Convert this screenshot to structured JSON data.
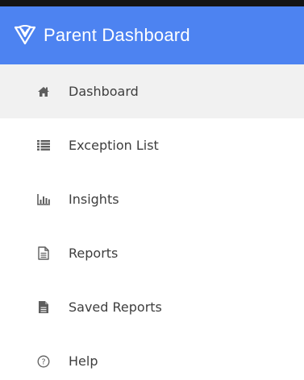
{
  "app": {
    "title": "Parent Dashboard",
    "logo_icon": "shield-heart-logo-icon",
    "header_color": "#4d83f1",
    "active_bg": "#f1f1f1"
  },
  "nav": {
    "items": [
      {
        "label": "Dashboard",
        "icon": "home-icon",
        "active": true
      },
      {
        "label": "Exception List",
        "icon": "list-icon",
        "active": false
      },
      {
        "label": "Insights",
        "icon": "bar-chart-icon",
        "active": false
      },
      {
        "label": "Reports",
        "icon": "document-outline-icon",
        "active": false
      },
      {
        "label": "Saved Reports",
        "icon": "document-filled-icon",
        "active": false
      },
      {
        "label": "Help",
        "icon": "help-circle-icon",
        "active": false
      }
    ]
  }
}
